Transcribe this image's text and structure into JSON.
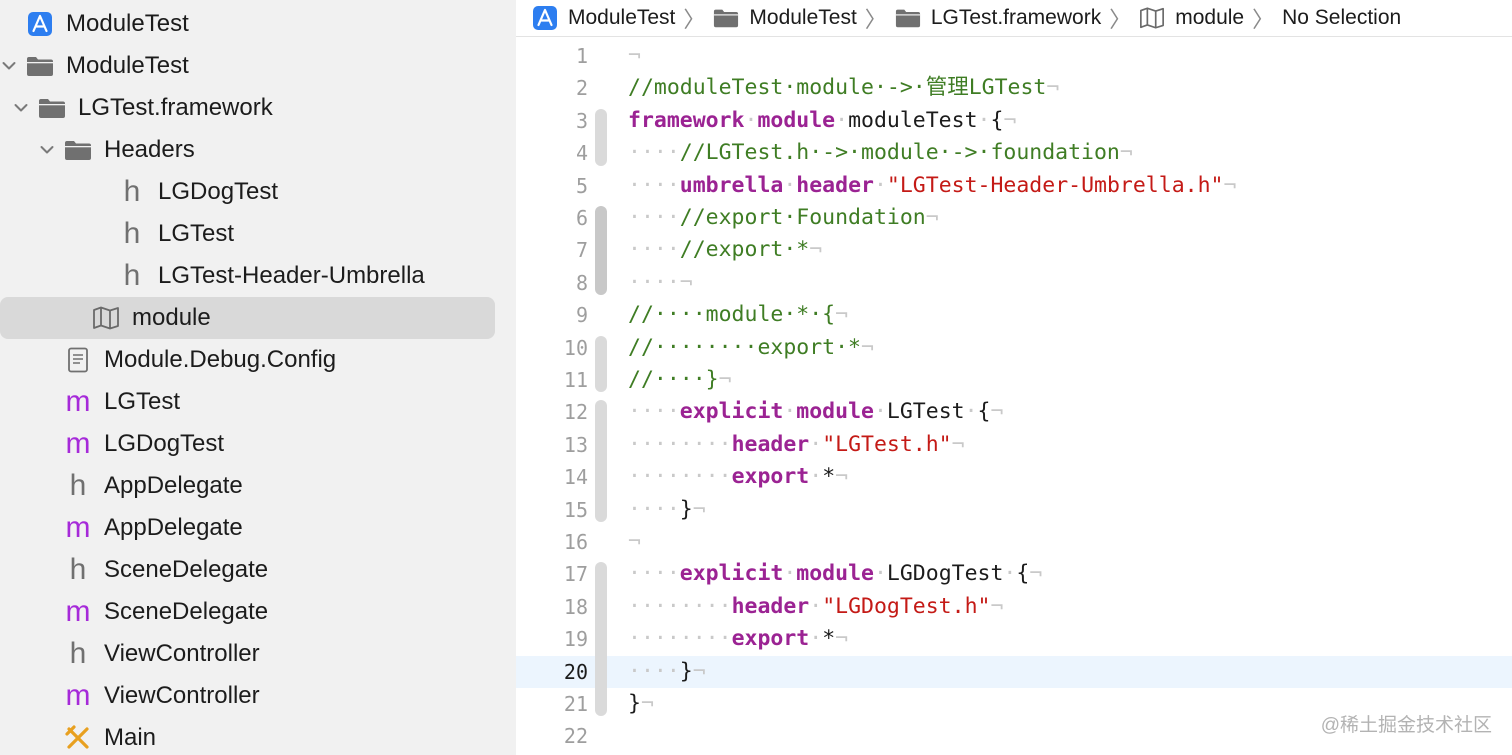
{
  "navigator": {
    "items": [
      {
        "label": "ModuleTest",
        "icon": "xcode-project-icon",
        "disclosure": "none",
        "selected": false
      },
      {
        "label": "ModuleTest",
        "icon": "folder-icon",
        "disclosure": "open",
        "selected": false
      },
      {
        "label": "LGTest.framework",
        "icon": "folder-icon",
        "disclosure": "open",
        "selected": false
      },
      {
        "label": "Headers",
        "icon": "folder-icon",
        "disclosure": "open",
        "selected": false
      },
      {
        "label": "LGDogTest",
        "icon": "header-file-icon",
        "disclosure": "none",
        "selected": false
      },
      {
        "label": "LGTest",
        "icon": "header-file-icon",
        "disclosure": "none",
        "selected": false
      },
      {
        "label": "LGTest-Header-Umbrella",
        "icon": "header-file-icon",
        "disclosure": "none",
        "selected": false
      },
      {
        "label": "module",
        "icon": "modulemap-icon",
        "disclosure": "none",
        "selected": true
      },
      {
        "label": "Module.Debug.Config",
        "icon": "config-file-icon",
        "disclosure": "none",
        "selected": false
      },
      {
        "label": "LGTest",
        "icon": "objc-impl-file-icon",
        "disclosure": "none",
        "selected": false
      },
      {
        "label": "LGDogTest",
        "icon": "objc-impl-file-icon",
        "disclosure": "none",
        "selected": false
      },
      {
        "label": "AppDelegate",
        "icon": "header-file-icon",
        "disclosure": "none",
        "selected": false
      },
      {
        "label": "AppDelegate",
        "icon": "objc-impl-file-icon",
        "disclosure": "none",
        "selected": false
      },
      {
        "label": "SceneDelegate",
        "icon": "header-file-icon",
        "disclosure": "none",
        "selected": false
      },
      {
        "label": "SceneDelegate",
        "icon": "objc-impl-file-icon",
        "disclosure": "none",
        "selected": false
      },
      {
        "label": "ViewController",
        "icon": "header-file-icon",
        "disclosure": "none",
        "selected": false
      },
      {
        "label": "ViewController",
        "icon": "objc-impl-file-icon",
        "disclosure": "none",
        "selected": false
      },
      {
        "label": "Main",
        "icon": "storyboard-icon",
        "disclosure": "none",
        "selected": false
      }
    ]
  },
  "jumpbar": {
    "items": [
      {
        "label": "ModuleTest",
        "icon": "xcode-project-icon"
      },
      {
        "label": "ModuleTest",
        "icon": "folder-icon"
      },
      {
        "label": "LGTest.framework",
        "icon": "folder-icon"
      },
      {
        "label": "module",
        "icon": "modulemap-icon"
      },
      {
        "label": "No Selection",
        "icon": ""
      }
    ],
    "separator": "〉"
  },
  "editor": {
    "current_line": 20,
    "lines": [
      {
        "n": "1",
        "tokens": [
          {
            "t": "¬",
            "c": "inv"
          }
        ]
      },
      {
        "n": "2",
        "tokens": [
          {
            "t": "//moduleTest·module·->·管理LGTest",
            "c": "com"
          },
          {
            "t": "¬",
            "c": "inv"
          }
        ]
      },
      {
        "n": "3",
        "tokens": [
          {
            "t": "framework",
            "c": "kw"
          },
          {
            "t": "·",
            "c": "inv"
          },
          {
            "t": "module",
            "c": "kw"
          },
          {
            "t": "·",
            "c": "inv"
          },
          {
            "t": "moduleTest",
            "c": "pl"
          },
          {
            "t": "·",
            "c": "inv"
          },
          {
            "t": "{",
            "c": "pl"
          },
          {
            "t": "¬",
            "c": "inv"
          }
        ]
      },
      {
        "n": "4",
        "tokens": [
          {
            "t": "····",
            "c": "inv"
          },
          {
            "t": "//LGTest.h·->·module·->·foundation",
            "c": "com"
          },
          {
            "t": "¬",
            "c": "inv"
          }
        ]
      },
      {
        "n": "5",
        "tokens": [
          {
            "t": "····",
            "c": "inv"
          },
          {
            "t": "umbrella",
            "c": "kw"
          },
          {
            "t": "·",
            "c": "inv"
          },
          {
            "t": "header",
            "c": "kw"
          },
          {
            "t": "·",
            "c": "inv"
          },
          {
            "t": "\"LGTest-Header-Umbrella.h\"",
            "c": "str"
          },
          {
            "t": "¬",
            "c": "inv"
          }
        ]
      },
      {
        "n": "6",
        "tokens": [
          {
            "t": "····",
            "c": "inv"
          },
          {
            "t": "//export·Foundation",
            "c": "com"
          },
          {
            "t": "¬",
            "c": "inv"
          }
        ]
      },
      {
        "n": "7",
        "tokens": [
          {
            "t": "····",
            "c": "inv"
          },
          {
            "t": "//export·*",
            "c": "com"
          },
          {
            "t": "¬",
            "c": "inv"
          }
        ]
      },
      {
        "n": "8",
        "tokens": [
          {
            "t": "····¬",
            "c": "inv"
          }
        ]
      },
      {
        "n": "9",
        "tokens": [
          {
            "t": "//····module·*·{",
            "c": "com"
          },
          {
            "t": "¬",
            "c": "inv"
          }
        ]
      },
      {
        "n": "10",
        "tokens": [
          {
            "t": "//········export·*",
            "c": "com"
          },
          {
            "t": "¬",
            "c": "inv"
          }
        ]
      },
      {
        "n": "11",
        "tokens": [
          {
            "t": "//····}",
            "c": "com"
          },
          {
            "t": "¬",
            "c": "inv"
          }
        ]
      },
      {
        "n": "12",
        "tokens": [
          {
            "t": "····",
            "c": "inv"
          },
          {
            "t": "explicit",
            "c": "kw"
          },
          {
            "t": "·",
            "c": "inv"
          },
          {
            "t": "module",
            "c": "kw"
          },
          {
            "t": "·",
            "c": "inv"
          },
          {
            "t": "LGTest",
            "c": "pl"
          },
          {
            "t": "·",
            "c": "inv"
          },
          {
            "t": "{",
            "c": "pl"
          },
          {
            "t": "¬",
            "c": "inv"
          }
        ]
      },
      {
        "n": "13",
        "tokens": [
          {
            "t": "········",
            "c": "inv"
          },
          {
            "t": "header",
            "c": "kw"
          },
          {
            "t": "·",
            "c": "inv"
          },
          {
            "t": "\"LGTest.h\"",
            "c": "str"
          },
          {
            "t": "¬",
            "c": "inv"
          }
        ]
      },
      {
        "n": "14",
        "tokens": [
          {
            "t": "········",
            "c": "inv"
          },
          {
            "t": "export",
            "c": "kw"
          },
          {
            "t": "·",
            "c": "inv"
          },
          {
            "t": "*",
            "c": "pl"
          },
          {
            "t": "¬",
            "c": "inv"
          }
        ]
      },
      {
        "n": "15",
        "tokens": [
          {
            "t": "····",
            "c": "inv"
          },
          {
            "t": "}",
            "c": "pl"
          },
          {
            "t": "¬",
            "c": "inv"
          }
        ]
      },
      {
        "n": "16",
        "tokens": [
          {
            "t": "¬",
            "c": "inv"
          }
        ]
      },
      {
        "n": "17",
        "tokens": [
          {
            "t": "····",
            "c": "inv"
          },
          {
            "t": "explicit",
            "c": "kw"
          },
          {
            "t": "·",
            "c": "inv"
          },
          {
            "t": "module",
            "c": "kw"
          },
          {
            "t": "·",
            "c": "inv"
          },
          {
            "t": "LGDogTest",
            "c": "pl"
          },
          {
            "t": "·",
            "c": "inv"
          },
          {
            "t": "{",
            "c": "pl"
          },
          {
            "t": "¬",
            "c": "inv"
          }
        ]
      },
      {
        "n": "18",
        "tokens": [
          {
            "t": "········",
            "c": "inv"
          },
          {
            "t": "header",
            "c": "kw"
          },
          {
            "t": "·",
            "c": "inv"
          },
          {
            "t": "\"LGDogTest.h\"",
            "c": "str"
          },
          {
            "t": "¬",
            "c": "inv"
          }
        ]
      },
      {
        "n": "19",
        "tokens": [
          {
            "t": "········",
            "c": "inv"
          },
          {
            "t": "export",
            "c": "kw"
          },
          {
            "t": "·",
            "c": "inv"
          },
          {
            "t": "*",
            "c": "pl"
          },
          {
            "t": "¬",
            "c": "inv"
          }
        ]
      },
      {
        "n": "20",
        "tokens": [
          {
            "t": "····",
            "c": "inv"
          },
          {
            "t": "}",
            "c": "pl"
          },
          {
            "t": "¬",
            "c": "inv"
          }
        ]
      },
      {
        "n": "21",
        "tokens": [
          {
            "t": "}",
            "c": "pl"
          },
          {
            "t": "¬",
            "c": "inv"
          }
        ]
      },
      {
        "n": "22",
        "tokens": []
      }
    ]
  },
  "colors": {
    "keyword": "#9b2393",
    "comment": "#3f7d24",
    "string": "#c41a16",
    "invisible": "#c9c9c9",
    "current_line_bg": "#ecf5fe",
    "selection_bg": "#d9d9d9"
  },
  "watermark": "@稀土掘金技术社区"
}
